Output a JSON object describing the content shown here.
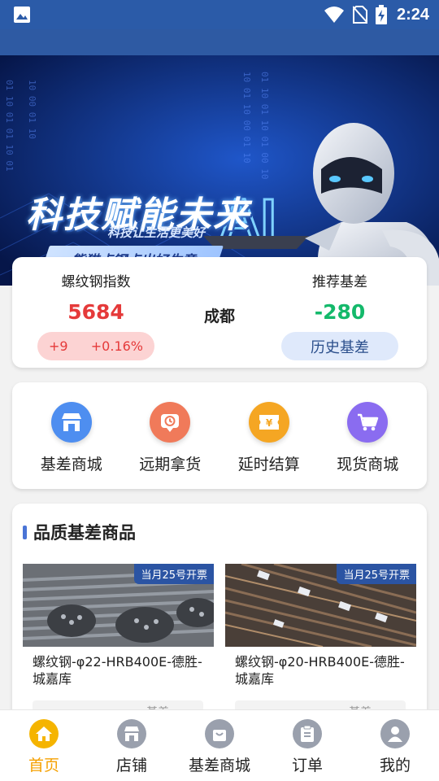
{
  "status_bar": {
    "time": "2:24"
  },
  "banner": {
    "headline": "科技赋能未来",
    "subline": "科技让生活更美好",
    "ribbon": "熊猫点钢点出好生意",
    "ai_text": "AI",
    "dots": {
      "count": 3,
      "active_index": 0
    }
  },
  "index_card": {
    "left_label": "螺纹钢指数",
    "left_value": "5684",
    "change_abs": "+9",
    "change_pct": "+0.16%",
    "city": "成都",
    "right_label": "推荐基差",
    "right_value": "-280",
    "history_button": "历史基差"
  },
  "menu": [
    {
      "label": "基差商城",
      "icon": "store-icon",
      "color": "#4e8ef0"
    },
    {
      "label": "远期拿货",
      "icon": "clock-icon",
      "color": "#f07a5a"
    },
    {
      "label": "延时结算",
      "icon": "ticket-icon",
      "color": "#f5a623"
    },
    {
      "label": "现货商城",
      "icon": "cart-icon",
      "color": "#8a6cf0"
    }
  ],
  "goods": {
    "section_title": "品质基差商品",
    "items": [
      {
        "tag": "当月25号开票",
        "name": "螺纹钢-φ22-HRB400E-德胜-城嘉库",
        "price_label": "基差"
      },
      {
        "tag": "当月25号开票",
        "name": "螺纹钢-φ20-HRB400E-德胜-城嘉库",
        "price_label": "基差"
      }
    ]
  },
  "tabs": [
    {
      "label": "首页",
      "icon": "home-icon",
      "active": true
    },
    {
      "label": "店铺",
      "icon": "shop-icon",
      "active": false
    },
    {
      "label": "基差商城",
      "icon": "bag-icon",
      "active": false
    },
    {
      "label": "订单",
      "icon": "clipboard-icon",
      "active": false
    },
    {
      "label": "我的",
      "icon": "user-icon",
      "active": false
    }
  ],
  "colors": {
    "primary": "#2b5ba8",
    "accent": "#f5b400",
    "up_red": "#e53a3a",
    "green": "#14b96b"
  }
}
